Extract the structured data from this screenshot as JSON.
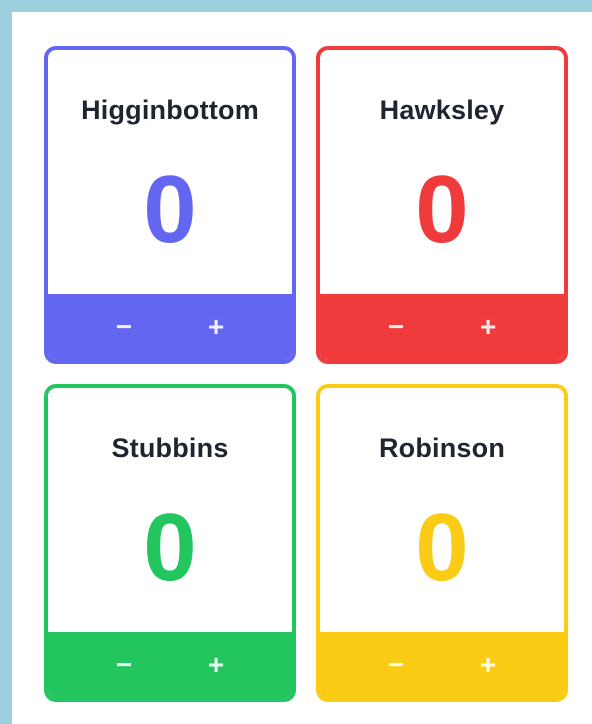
{
  "players": [
    {
      "name": "Higginbottom",
      "score": "0",
      "color": "#6366f1",
      "minus_label": "−",
      "plus_label": "+"
    },
    {
      "name": "Hawksley",
      "score": "0",
      "color": "#ef3b3b",
      "minus_label": "−",
      "plus_label": "+"
    },
    {
      "name": "Stubbins",
      "score": "0",
      "color": "#22c55e",
      "minus_label": "−",
      "plus_label": "+"
    },
    {
      "name": "Robinson",
      "score": "0",
      "color": "#facc15",
      "minus_label": "−",
      "plus_label": "+"
    }
  ]
}
